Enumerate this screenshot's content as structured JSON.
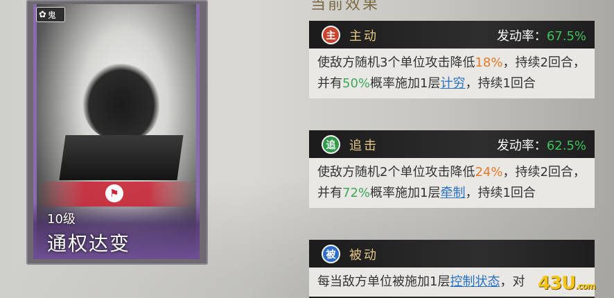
{
  "card": {
    "badge": "鬼",
    "level": "10级",
    "name": "通权达变",
    "emblem_icon": "banner-icon"
  },
  "panel": {
    "title": "当前效果"
  },
  "effects": [
    {
      "type_icon_char": "主",
      "type_label": "主动",
      "icon_color": "#c8442e",
      "rate_label": "发动率：",
      "rate_value": "67.5%",
      "parts": [
        "使敌方随机3个单位攻击降低",
        "18%",
        "，持续2回合，并有",
        "50%",
        "概率施加1层",
        "计穷",
        "，持续1回合"
      ]
    },
    {
      "type_icon_char": "追",
      "type_label": "追击",
      "icon_color": "#2e9a4a",
      "rate_label": "发动率：",
      "rate_value": "62.5%",
      "parts": [
        "使敌方随机2个单位攻击降低",
        "24%",
        "，持续2回合，并有",
        "72%",
        "概率施加1层",
        "牵制",
        "，持续1回合"
      ]
    },
    {
      "type_icon_char": "被",
      "type_label": "被动",
      "icon_color": "#2e6ec8",
      "parts": [
        "每当敌方单位被施加1层",
        "控制状态",
        "，对"
      ]
    }
  ],
  "watermark": {
    "main": "43U",
    "suffix": ".com"
  },
  "colors": {
    "highlight_orange": "#e07a2a",
    "highlight_green": "#3ea85a",
    "link_blue": "#2b72c2",
    "rate_green": "#3ec25a",
    "label_gold": "#e6c88a",
    "card_purple": "#8a6bb1"
  }
}
